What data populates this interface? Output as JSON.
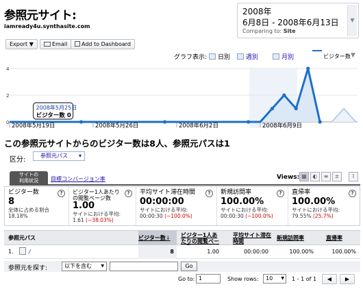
{
  "header": {
    "title": "参照元サイト:",
    "site": "iamready4u.synthasite.com"
  },
  "date": {
    "year": "2008年",
    "range": "6月8日 - 2008年6月13日",
    "comparing_label": "Comparing to:",
    "comparing_value": "Site",
    "dropdown": "▼"
  },
  "toolbar": {
    "export": "Export",
    "export_arrow": "▼",
    "email": "Email",
    "dashboard": "Add to Dashboard"
  },
  "graph_bar": {
    "label": "グラフ表示:",
    "day": "日別",
    "week": "週別",
    "month": "月別",
    "metric": "ビジター数",
    "dropdown": "▼"
  },
  "chart_data": {
    "type": "area",
    "ylim": [
      0,
      4
    ],
    "yticks": [
      "4",
      "2",
      "0"
    ],
    "xlabels": [
      "2008年5月19日",
      "2008年5月26日",
      "2008年6月2日",
      "2008年6月9日"
    ],
    "series": [
      {
        "name": "ビジター数",
        "points": [
          [
            0,
            0
          ],
          [
            1,
            0
          ],
          [
            2,
            0
          ],
          [
            3,
            0
          ],
          [
            4,
            0
          ],
          [
            5,
            0
          ],
          [
            6,
            0
          ],
          [
            7,
            0
          ],
          [
            8,
            0
          ],
          [
            9,
            0
          ],
          [
            10,
            0
          ],
          [
            11,
            0
          ],
          [
            12,
            0
          ],
          [
            13,
            0
          ],
          [
            14,
            0
          ],
          [
            15,
            0
          ],
          [
            16,
            0
          ],
          [
            17,
            0
          ],
          [
            18,
            0
          ],
          [
            19,
            0
          ],
          [
            20,
            0
          ],
          [
            21,
            0
          ],
          [
            22,
            1
          ],
          [
            23,
            2
          ],
          [
            24,
            1
          ],
          [
            25,
            4
          ],
          [
            26,
            0
          ]
        ]
      }
    ],
    "comparison_points": [
      [
        27,
        0
      ],
      [
        28,
        1
      ],
      [
        29,
        0
      ]
    ],
    "tooltip": {
      "date": "2008年5月25日",
      "text": "ビジター数 0",
      "index": 6
    },
    "colors": {
      "line": "#1f6fc8",
      "fill": "#dbe8f6",
      "compare": "#b8cce8"
    }
  },
  "summary": "この参照元サイトからのビジター数は8人、参照元パスは1",
  "segment": {
    "label": "区分:",
    "value": "参照元パス",
    "arrow": "▾"
  },
  "tabs": {
    "tab1": "サイトの\n利用状況",
    "tab2": "目標コンバージョン率"
  },
  "views_label": "Views:",
  "metrics": [
    {
      "label": "ビジター数",
      "value": "8",
      "sub1": "全体に占める割合",
      "sub2": "18.18%",
      "sub2b": ""
    },
    {
      "label": "ビジター1人あたりの閲覧ページ数",
      "value": "1.00",
      "sub1": "サイトにおける平均:",
      "sub2": "1.61",
      "sub2b": "(−38.03%)"
    },
    {
      "label": "平均サイト滞在時間",
      "value": "00:00:00",
      "sub1": "サイトにおける平均:",
      "sub2": "00:00:30",
      "sub2b": "(−100.0%)"
    },
    {
      "label": "新規訪問率",
      "value": "100.00%",
      "sub1": "サイトにおける平均:",
      "sub2": "00:00:30",
      "sub2b": "(−100.0%)"
    },
    {
      "label": "直帰率",
      "value": "100.00%",
      "sub1": "サイトにおける平均:",
      "sub2": "79.55%",
      "sub2b": "(25.7%)"
    }
  ],
  "table": {
    "headers": [
      "参照元パス",
      "ビジター数",
      "ビジター1人あたりの閲覧ページ数",
      "平均サイト滞在時間",
      "新規訪問率",
      "直帰率"
    ],
    "sort_arrow": "↓",
    "rows": [
      {
        "num": "1.",
        "path": "/",
        "visitors": "8",
        "pages": "1.00",
        "time": "00:00:00",
        "new": "100.00%",
        "bounce": "100.00%"
      }
    ]
  },
  "find": {
    "label": "参照元を探す:",
    "option": "以下を含む",
    "arrow": "▼",
    "go": "Go"
  },
  "pager": {
    "goto_label": "Go to:",
    "goto_value": "1",
    "rows_label": "Show rows:",
    "rows_value": "10",
    "range": "1 - 1 of 1",
    "prev": "◀",
    "next": "▶"
  }
}
